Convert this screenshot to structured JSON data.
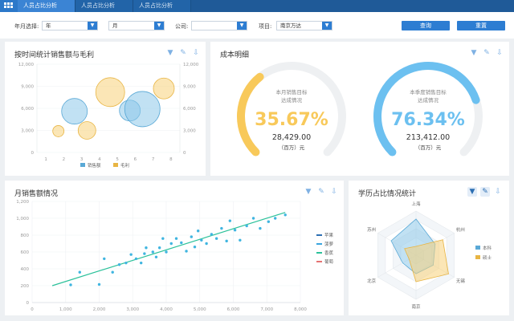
{
  "tabs": [
    {
      "label": "人员占比分析"
    },
    {
      "label": "人员占比分析"
    },
    {
      "label": "人员占比分析"
    }
  ],
  "filters": {
    "year_label": "年月选择:",
    "year_value": "年",
    "month_value": "月",
    "company_label": "公司:",
    "company_value": "",
    "project_label": "项目:",
    "project_value": "南京万达",
    "query_label": "查询",
    "reset_label": "重置"
  },
  "panel_bubble": {
    "title": "按时间统计销售额与毛利",
    "legend": [
      "销售额",
      "毛利"
    ]
  },
  "panel_cost": {
    "title": "成本明细",
    "gauges": [
      {
        "caption1": "本月销售目标",
        "caption2": "达成情况",
        "percent": "35.67%",
        "amount": "28,429.00",
        "unit": "（百万）元",
        "fraction": 0.3567,
        "color": "#f8c95a"
      },
      {
        "caption1": "本季度销售目标",
        "caption2": "达成情况",
        "percent": "76.34%",
        "amount": "213,412.00",
        "unit": "（百万）元",
        "fraction": 0.7634,
        "color": "#6cc0f0"
      }
    ]
  },
  "panel_monthly": {
    "title": "月销售额情况",
    "legend": [
      "苹果",
      "菠萝",
      "香蕉",
      "葡萄"
    ]
  },
  "panel_radar": {
    "title": "学历占比情况统计",
    "legend": [
      "本科",
      "硕士"
    ]
  },
  "colors": {
    "primary": "#2d7dd2",
    "blue_series": "#8ec9ea",
    "yellow_series": "#f8d27a",
    "line_series": "#2bc19a",
    "scatter": "#3fb5e0"
  },
  "chart_data": [
    {
      "type": "scatter",
      "title": "按时间统计销售额与毛利",
      "x": {
        "categories": [
          "1",
          "2",
          "3",
          "4",
          "5",
          "6",
          "7",
          "8"
        ]
      },
      "ylim": [
        0,
        12000
      ],
      "yticks": [
        "0",
        "3,000",
        "6,000",
        "9,000",
        "12,000"
      ],
      "series": [
        {
          "name": "销售额",
          "points": [
            [
              2.6,
              5600,
              16
            ],
            [
              5.7,
              5700,
              13
            ],
            [
              6.4,
              5900,
              22
            ]
          ]
        },
        {
          "name": "毛利",
          "points": [
            [
              1.7,
              2900,
              7
            ],
            [
              3.3,
              3000,
              11
            ],
            [
              4.6,
              8200,
              18
            ],
            [
              7.6,
              8700,
              13
            ]
          ]
        }
      ],
      "legend": "bottom"
    },
    {
      "type": "scatter",
      "title": "月销售额情况",
      "xlim": [
        0,
        8000
      ],
      "ylim": [
        0,
        1200
      ],
      "xticks": [
        "0",
        "1,000",
        "2,000",
        "3,000",
        "4,000",
        "5,000",
        "6,000",
        "7,000",
        "8,000"
      ],
      "yticks": [
        "0",
        "200",
        "400",
        "600",
        "800",
        "1,000",
        "1,200"
      ],
      "points": [
        [
          1150,
          210
        ],
        [
          1420,
          360
        ],
        [
          2000,
          215
        ],
        [
          2150,
          520
        ],
        [
          2400,
          360
        ],
        [
          2600,
          450
        ],
        [
          2800,
          470
        ],
        [
          2950,
          570
        ],
        [
          3100,
          520
        ],
        [
          3250,
          470
        ],
        [
          3350,
          580
        ],
        [
          3400,
          650
        ],
        [
          3600,
          600
        ],
        [
          3700,
          540
        ],
        [
          3800,
          650
        ],
        [
          3900,
          760
        ],
        [
          4000,
          600
        ],
        [
          4150,
          700
        ],
        [
          4300,
          760
        ],
        [
          4450,
          710
        ],
        [
          4600,
          610
        ],
        [
          4750,
          780
        ],
        [
          4850,
          660
        ],
        [
          4950,
          850
        ],
        [
          5050,
          740
        ],
        [
          5200,
          700
        ],
        [
          5350,
          810
        ],
        [
          5500,
          760
        ],
        [
          5650,
          880
        ],
        [
          5800,
          730
        ],
        [
          5900,
          970
        ],
        [
          6050,
          860
        ],
        [
          6200,
          740
        ],
        [
          6400,
          910
        ],
        [
          6600,
          1000
        ],
        [
          6800,
          880
        ],
        [
          7050,
          960
        ],
        [
          7250,
          1000
        ],
        [
          7550,
          1040
        ]
      ],
      "trend": [
        [
          600,
          200
        ],
        [
          7550,
          1070
        ]
      ],
      "legend": "right"
    },
    {
      "type": "radar",
      "title": "学历占比情况统计",
      "axes": [
        "上海",
        "杭州",
        "无锡",
        "南京",
        "北京",
        "苏州"
      ],
      "max": 100,
      "series": [
        {
          "name": "本科",
          "values": [
            82,
            50,
            45,
            42,
            35,
            65
          ]
        },
        {
          "name": "硕士",
          "values": [
            20,
            70,
            85,
            60,
            18,
            30
          ]
        }
      ],
      "legend": "right"
    }
  ]
}
